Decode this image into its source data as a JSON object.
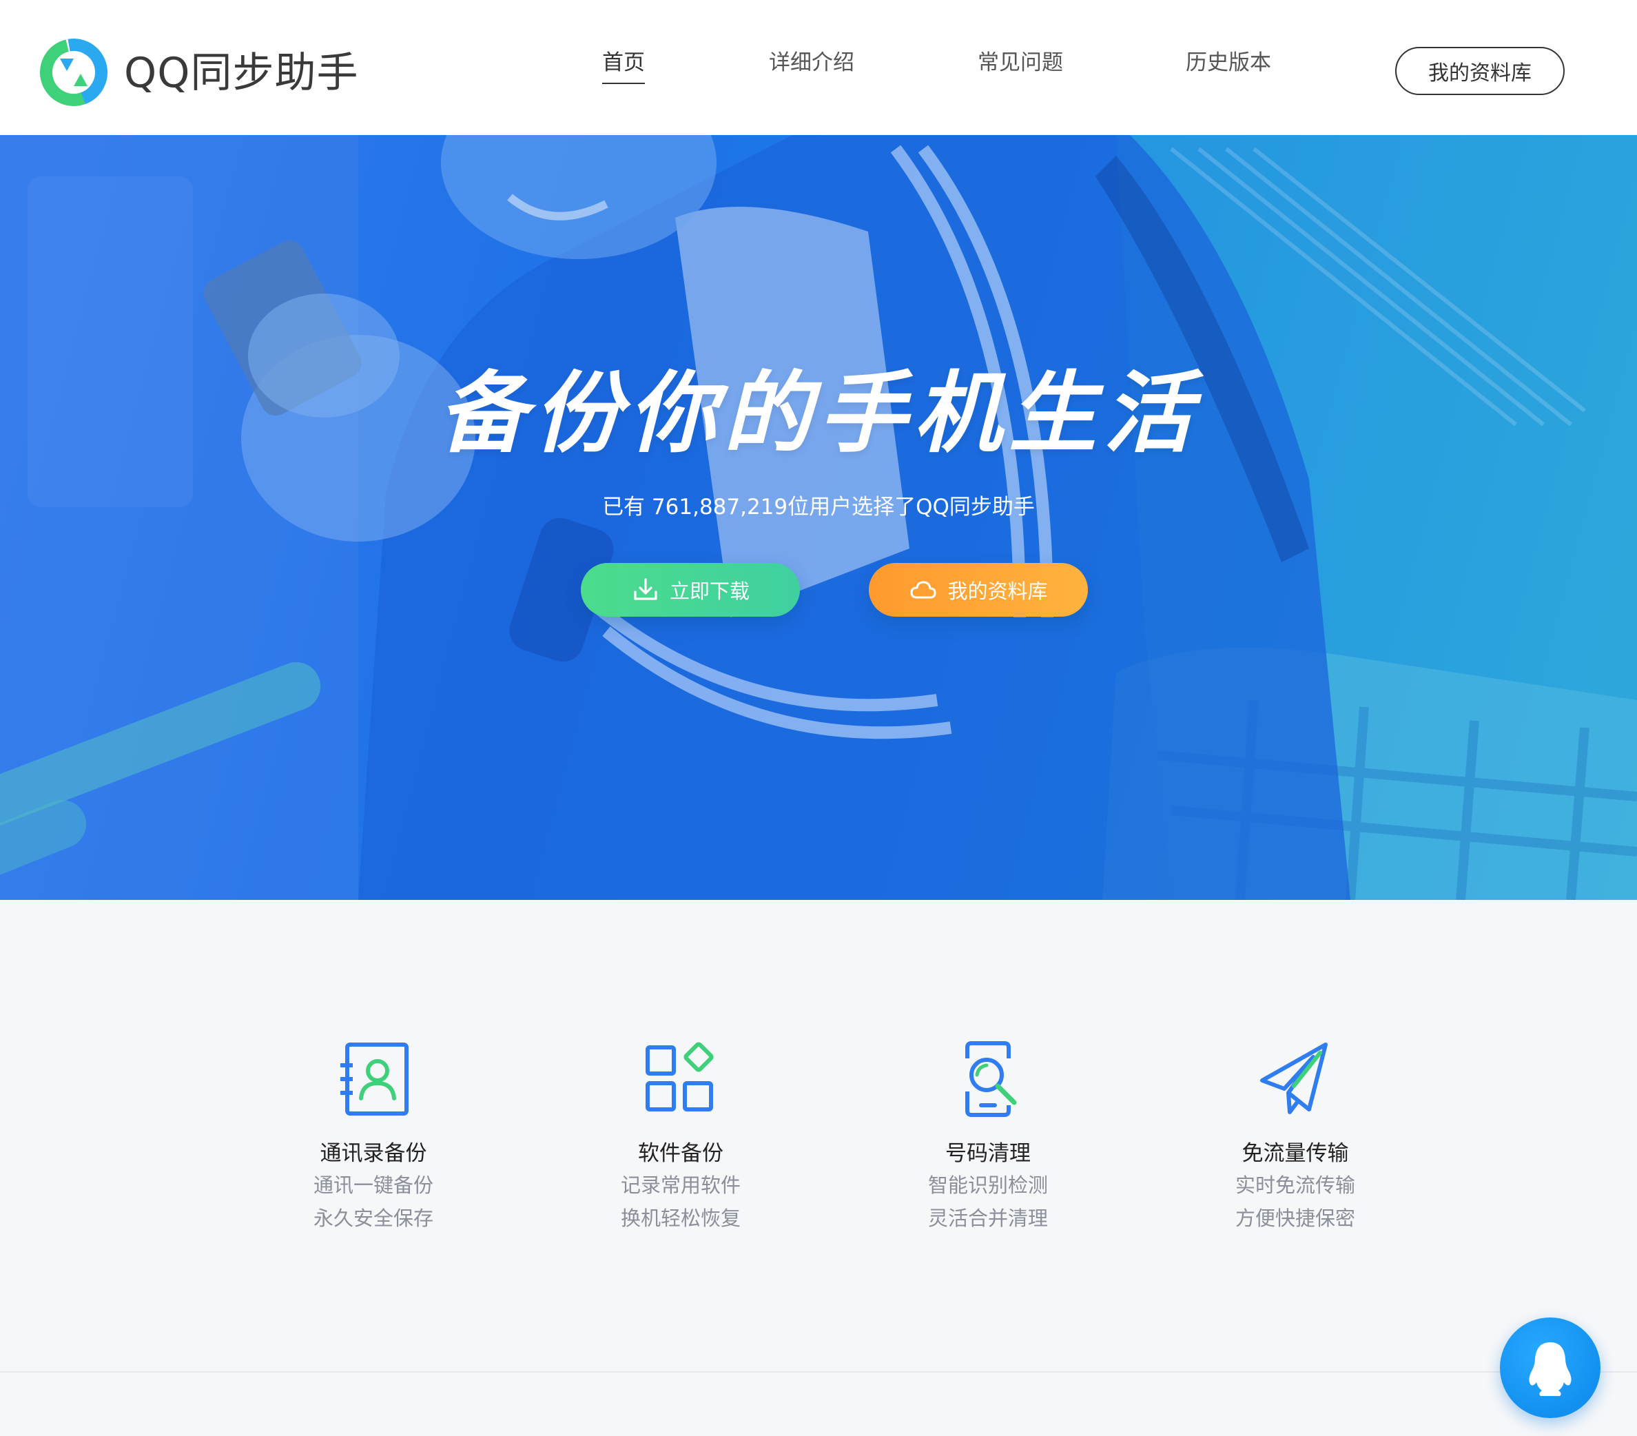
{
  "header": {
    "brand": "QQ同步助手",
    "nav": [
      "首页",
      "详细介绍",
      "常见问题",
      "历史版本"
    ],
    "active_nav": "首页",
    "library_button": "我的资料库"
  },
  "hero": {
    "title": "备份你的手机生活",
    "subtitle": "已有 761,887,219位用户选择了QQ同步助手",
    "download_button": "立即下载",
    "library_button": "我的资料库"
  },
  "features": [
    {
      "icon": "contacts-backup-icon",
      "title": "通讯录备份",
      "line1": "通讯一键备份",
      "line2": "永久安全保存"
    },
    {
      "icon": "apps-backup-icon",
      "title": "软件备份",
      "line1": "记录常用软件",
      "line2": "换机轻松恢复"
    },
    {
      "icon": "phone-search-icon",
      "title": "号码清理",
      "line1": "智能识别检测",
      "line2": "灵活合并清理"
    },
    {
      "icon": "paper-plane-icon",
      "title": "免流量传输",
      "line1": "实时免流传输",
      "line2": "方便快捷保密"
    }
  ],
  "floating": {
    "icon": "qq-penguin-icon"
  },
  "colors": {
    "hero_blue": "#1f73e8",
    "download_green": "#4cdc8c",
    "library_orange": "#ff9a2e",
    "icon_blue": "#2f7df0",
    "icon_green": "#3fd17a"
  }
}
